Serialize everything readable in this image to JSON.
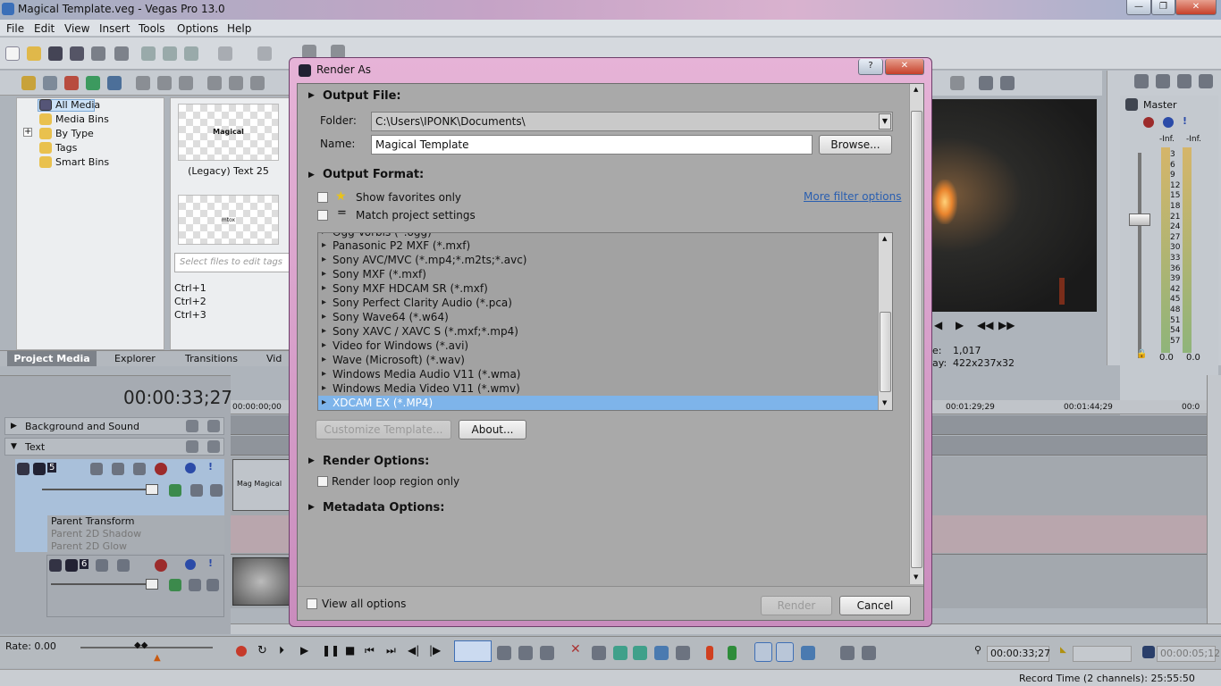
{
  "window": {
    "title": "Magical Template.veg - Vegas Pro 13.0",
    "min": "—",
    "max": "❐",
    "close": "✕"
  },
  "menu": [
    "File",
    "Edit",
    "View",
    "Insert",
    "Tools",
    "Options",
    "Help"
  ],
  "explorer": {
    "items": [
      {
        "label": "All Media"
      },
      {
        "label": "Media Bins"
      },
      {
        "label": "By Type"
      },
      {
        "label": "Tags"
      },
      {
        "label": "Smart Bins"
      }
    ]
  },
  "media": {
    "thumb1_text": "Magical",
    "thumb1_caption": "(Legacy) Text 25",
    "thumb2_text": "mtox",
    "tags_placeholder": "Select files to edit tags",
    "shortcuts": [
      "Ctrl+1",
      "Ctrl+2",
      "Ctrl+3"
    ]
  },
  "tabs": [
    "Project Media",
    "Explorer",
    "Transitions",
    "Vid"
  ],
  "timeline": {
    "timecode": "00:00:33;27",
    "ruler": [
      "00:00:00;00",
      "00:01:29;29",
      "00:01:44;29",
      "00:0"
    ],
    "tracks": [
      {
        "name": "Background and Sound"
      },
      {
        "name": "Text"
      }
    ],
    "track_num1": "5",
    "track_num2": "6",
    "fx": [
      "Parent Transform",
      "Parent 2D Shadow",
      "Parent 2D Glow"
    ],
    "clip_text": "Mag Magical"
  },
  "preview": {
    "frame_label": "e:",
    "frame_value": "1,017",
    "display_label": "ay:",
    "display_value": "422x237x32"
  },
  "master": {
    "title": "Master",
    "left_inf": "-Inf.",
    "right_inf": "-Inf.",
    "ticks": [
      "3",
      "6",
      "9",
      "12",
      "15",
      "18",
      "21",
      "24",
      "27",
      "30",
      "33",
      "36",
      "39",
      "42",
      "45",
      "48",
      "51",
      "54",
      "57"
    ],
    "bottom_left": "0.0",
    "bottom_right": "0.0"
  },
  "status": {
    "rate": "Rate: 0.00",
    "time": "00:00:33;27",
    "end": "00:00:05;12",
    "record": "Record Time (2 channels): 25:55:50"
  },
  "dialog": {
    "title": "Render As",
    "help": "?",
    "close": "✕",
    "output_file": "Output File:",
    "folder_label": "Folder:",
    "folder_value": "C:\\Users\\IPONK\\Documents\\",
    "name_label": "Name:",
    "name_value": "Magical Template",
    "browse": "Browse...",
    "output_format": "Output Format:",
    "favorites": "Show favorites only",
    "match": "Match project settings",
    "more_filter": "More filter options",
    "formats": [
      "Ogg Vorbis (*.ogg)",
      "Panasonic P2 MXF (*.mxf)",
      "Sony AVC/MVC (*.mp4;*.m2ts;*.avc)",
      "Sony MXF (*.mxf)",
      "Sony MXF HDCAM SR (*.mxf)",
      "Sony Perfect Clarity Audio (*.pca)",
      "Sony Wave64 (*.w64)",
      "Sony XAVC / XAVC S (*.mxf;*.mp4)",
      "Video for Windows (*.avi)",
      "Wave (Microsoft) (*.wav)",
      "Windows Media Audio V11 (*.wma)",
      "Windows Media Video V11 (*.wmv)",
      "XDCAM EX (*.MP4)"
    ],
    "customize": "Customize Template...",
    "about": "About...",
    "render_options": "Render Options:",
    "loop": "Render loop region only",
    "metadata": "Metadata Options:",
    "view_all": "View all options",
    "render": "Render",
    "cancel": "Cancel"
  },
  "colors": {
    "selection": "#7eb4ea",
    "link": "#2a5fb0",
    "dialog_frame": "#d8a3cc"
  }
}
